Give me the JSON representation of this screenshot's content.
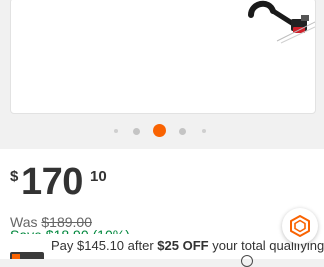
{
  "gallery": {
    "image_alt": "String trimmer product image",
    "slide_count": 5,
    "active_slide": 3
  },
  "pricing": {
    "currency_symbol": "$",
    "dollars": "170",
    "cents": "10",
    "was_label": "Was",
    "was_price": "$189.00",
    "save_text": "Save $18.90 (10%)"
  },
  "promo": {
    "text_prefix": "Pay",
    "amount": "$145.10",
    "text_middle": "after",
    "discount": "$25 OFF",
    "text_suffix": "your total qualifying"
  },
  "colors": {
    "brand_orange": "#f96302",
    "save_green": "#00873c",
    "text_dark": "#333333"
  },
  "icons": {
    "chat": "hexagon-chat-icon"
  }
}
